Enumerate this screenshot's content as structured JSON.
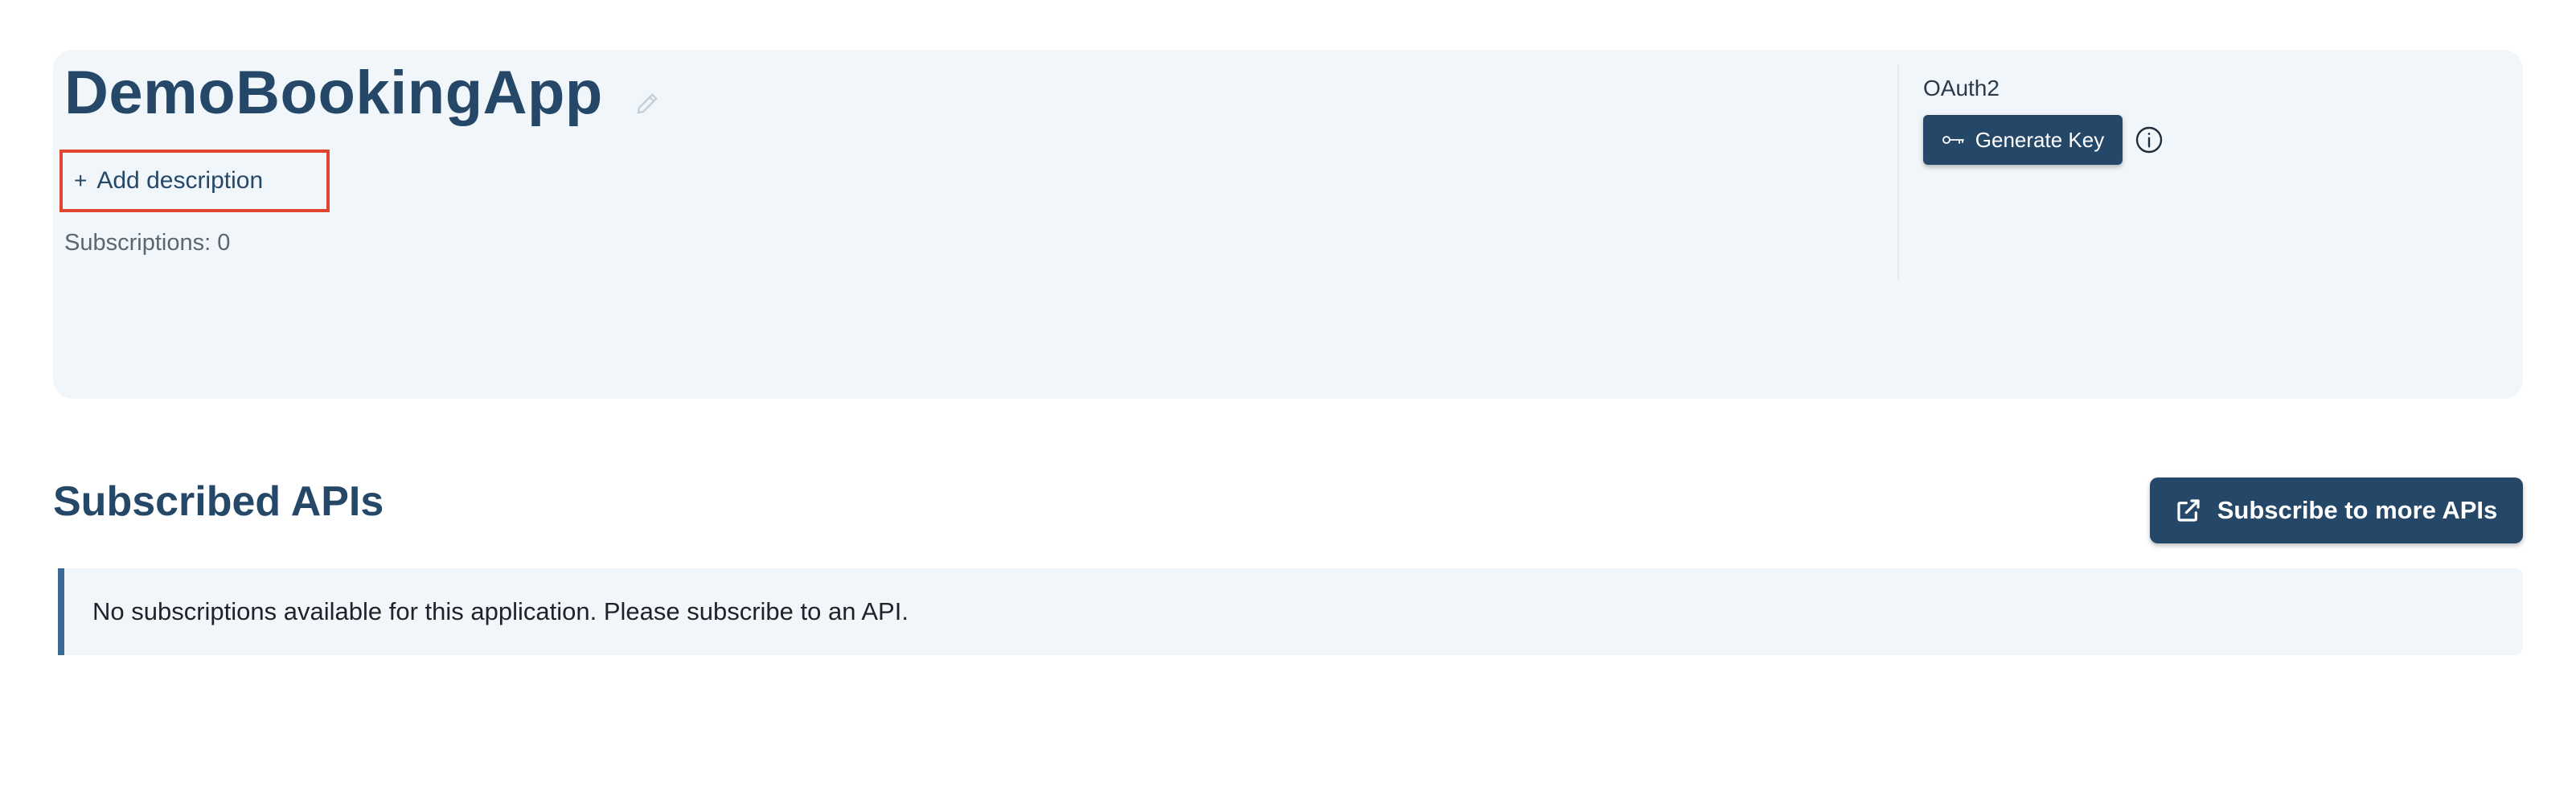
{
  "app": {
    "name": "DemoBookingApp",
    "add_description_label": "Add description",
    "add_description_prefix": "+",
    "subscriptions_text": "Subscriptions: 0",
    "auth_type": "OAuth2",
    "generate_key_label": "Generate Key"
  },
  "subscribed_apis": {
    "title": "Subscribed APIs",
    "subscribe_button_label": "Subscribe to more APIs",
    "empty_message": "No subscriptions available for this application. Please subscribe to an API."
  },
  "icons": {
    "edit": "pencil-icon",
    "key": "key-icon",
    "info": "info-icon",
    "external": "external-link-icon"
  },
  "colors": {
    "primary": "#264868",
    "card_bg": "#f1f6fa",
    "highlight_border": "#e0452f",
    "alert_accent": "#3b6a96"
  }
}
